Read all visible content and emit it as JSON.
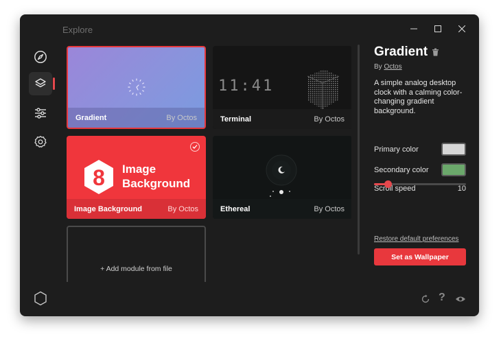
{
  "window": {
    "title": "Explore"
  },
  "nav": {
    "items": [
      {
        "icon": "compass-icon"
      },
      {
        "icon": "layers-icon",
        "active": true
      },
      {
        "icon": "sliders-icon"
      },
      {
        "icon": "gear-icon"
      }
    ],
    "bottom_icon": "hexagon-icon"
  },
  "modules": [
    {
      "name": "Gradient",
      "author": "By Octos",
      "selected": true
    },
    {
      "name": "Terminal",
      "author": "By Octos",
      "clock_text": "11:41"
    },
    {
      "name": "Image Background",
      "author": "By Octos",
      "checked": true,
      "logo_text_line1": "Image",
      "logo_text_line2": "Background"
    },
    {
      "name": "Ethereal",
      "author": "By Octos"
    }
  ],
  "add_module": {
    "label": "+ Add module from file"
  },
  "panel": {
    "title": "Gradient",
    "by_prefix": "By",
    "author": "Octos",
    "description": "A simple analog desktop clock with a calming color-changing gradient background.",
    "primary_label": "Primary color",
    "primary_color": "#d6d6d6",
    "secondary_label": "Secondary color",
    "secondary_color": "#6ba86b",
    "scroll_label": "Scroll speed",
    "scroll_value": "10",
    "scroll_fraction": 0.15,
    "restore_label": "Restore default preferences",
    "set_label": "Set as Wallpaper"
  },
  "colors": {
    "accent": "#e8383d",
    "gradient_start": "#9b86d9",
    "gradient_end": "#7a9be0"
  }
}
